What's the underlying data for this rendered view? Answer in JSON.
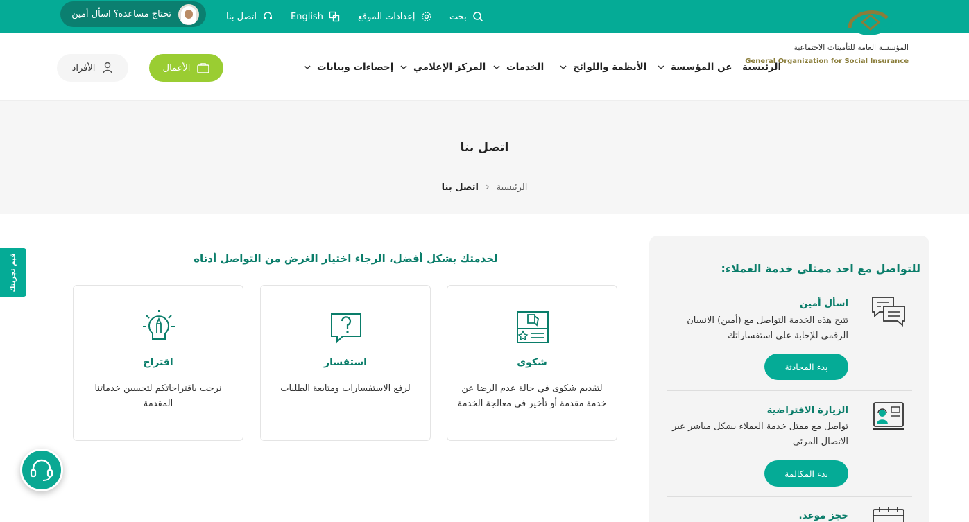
{
  "topbar": {
    "search": "بحث",
    "settings": "إعدادات الموقع",
    "language": "English",
    "contact": "اتصل بنا",
    "ask_ameen": "تحتاج مساعدة؟ اسأل أمين"
  },
  "logo": {
    "arabic": "المؤسسة العامة للتأمينات الاجتماعية",
    "english": "General Organization for Social Insurance"
  },
  "nav": {
    "items": [
      {
        "label": "الرئيسية"
      },
      {
        "label": "عن المؤسسة"
      },
      {
        "label": "الأنظمة واللوائح"
      },
      {
        "label": "الخدمات"
      },
      {
        "label": "المركز الإعلامي"
      },
      {
        "label": "إحصاءات وبيانات"
      }
    ],
    "business": "الأعمال",
    "individuals": "الأفراد"
  },
  "page": {
    "title": "اتصل بنا",
    "breadcrumb": {
      "home": "الرئيسية",
      "current": "اتصل بنا"
    }
  },
  "sidetab": "قيم تجربتك",
  "intro": "لخدمتك بشكل أفضل، الرجاء اختيار الغرض من التواصل أدناه",
  "cards": [
    {
      "icon": "complaint-icon",
      "title": "شكوى",
      "desc": "لتقديم شكوى في حالة عدم الرضا عن خدمة مقدمة أو تأخير في معالجة الخدمة"
    },
    {
      "icon": "inquiry-icon",
      "title": "استفسار",
      "desc": "لرفع الاستفسارات ومتابعة الطلبات"
    },
    {
      "icon": "suggestion-icon",
      "title": "اقتراح",
      "desc": "نرحب باقتراحاتكم لتحسين خدماتنا المقدمة"
    }
  ],
  "panel": {
    "title": "للتواصل مع احد ممثلي خدمة العملاء:",
    "services": [
      {
        "title": "اسأل أمين",
        "desc": "تتيح هذه الخدمة التواصل مع (أمين) الانسان الرقمي للإجابة على استفساراتك",
        "button": "بدء المحادثة"
      },
      {
        "title": "الزيارة الافتراضية",
        "desc": "تواصل مع ممثل خدمة العملاء بشكل مباشر عبر الاتصال المرئي",
        "button": "بدء المكالمة"
      },
      {
        "title": "حجز موعد."
      }
    ]
  },
  "colors": {
    "primary": "#05ab96",
    "dark": "#0a7d6a",
    "business": "#9acd32"
  }
}
